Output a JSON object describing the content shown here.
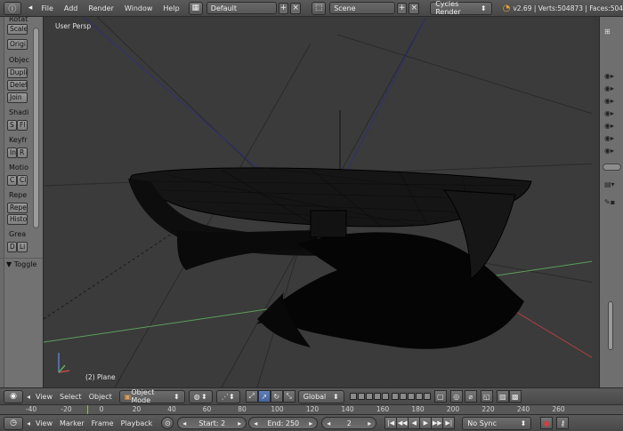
{
  "topbar": {
    "menus": [
      "File",
      "Add",
      "Render",
      "Window",
      "Help"
    ],
    "screen_layout": "Default",
    "scene": "Scene",
    "render_engine": "Cycles Render",
    "stats": "v2.69 | Verts:504873 | Faces:504"
  },
  "toolshelf": {
    "sections": [
      {
        "label": "Rotat",
        "buttons": [
          "Scale",
          "Origi"
        ]
      },
      {
        "label": "Objec",
        "buttons": [
          "Dupli",
          "Delet",
          "Join"
        ]
      },
      {
        "label": "Shadi",
        "buttons": [
          "S",
          "Fl"
        ]
      },
      {
        "label": "Keyfr",
        "buttons": [
          "In",
          "R"
        ]
      },
      {
        "label": "Motio",
        "buttons": [
          "C",
          "Cl"
        ]
      },
      {
        "label": "Repe",
        "buttons": [
          "Repe",
          "Histo"
        ]
      },
      {
        "label": "Grea",
        "buttons": [
          "D",
          "Li"
        ]
      }
    ],
    "toggle_label": "Toggle"
  },
  "viewport": {
    "view_name": "User Persp",
    "object_label": "(2) Plane",
    "bg_color": "#3b3b3b"
  },
  "view_header": {
    "menus": [
      "View",
      "Select",
      "Object"
    ],
    "mode": "Object Mode",
    "orientation": "Global"
  },
  "ruler": {
    "ticks": [
      "-40",
      "-20",
      "0",
      "20",
      "40",
      "60",
      "80",
      "100",
      "120",
      "140",
      "160",
      "180",
      "200",
      "220",
      "240",
      "260"
    ],
    "current_frame": 2
  },
  "timeline": {
    "menus": [
      "View",
      "Marker",
      "Frame",
      "Playback"
    ],
    "start": "Start: 2",
    "end": "End: 250",
    "current": "2",
    "sync": "No Sync"
  },
  "colors": {
    "accent_blue": "#5d7fb8",
    "x_axis": "#b04040",
    "y_axis": "#5aa05a"
  }
}
